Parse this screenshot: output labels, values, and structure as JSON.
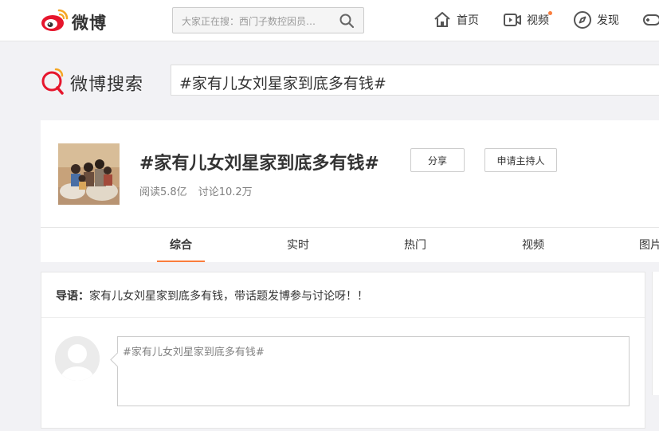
{
  "topnav": {
    "logo_text": "微博",
    "search_placeholder": "大家正在搜：西门子数控因员…",
    "items": [
      {
        "label": "首页",
        "icon": "home-icon"
      },
      {
        "label": "视频",
        "icon": "video-icon",
        "has_dot": true
      },
      {
        "label": "发现",
        "icon": "compass-icon"
      },
      {
        "label": "",
        "icon": "game-icon"
      }
    ]
  },
  "search": {
    "logo_text": "微博搜索",
    "query": "#家有儿女刘星家到底多有钱#"
  },
  "topic": {
    "title": "#家有儿女刘星家到底多有钱#",
    "share_label": "分享",
    "apply_host_label": "申请主持人",
    "reads": "阅读5.8亿",
    "discussions": "讨论10.2万",
    "tabs": [
      "综合",
      "实时",
      "热门",
      "视频",
      "图片"
    ],
    "active_tab": "综合"
  },
  "intro": {
    "lead_label": "导语：",
    "lead_text": "家有儿女刘星家到底多有钱，带话题发博参与讨论呀！！"
  },
  "compose": {
    "text": "#家有儿女刘星家到底多有钱#"
  },
  "colors": {
    "accent": "#fa7d3c",
    "brand_red": "#e6162d"
  }
}
